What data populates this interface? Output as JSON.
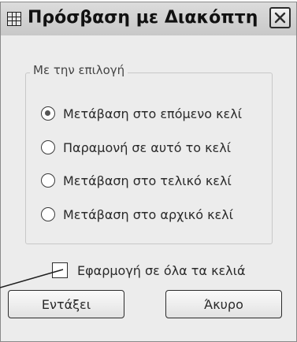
{
  "window": {
    "title": "Πρόσβαση με Διακόπτη",
    "icons": {
      "app": "grid-icon",
      "close": "close-icon"
    }
  },
  "group": {
    "legend": "Με την επιλογή",
    "options": [
      {
        "label": "Μετάβαση στο επόμενο κελί",
        "selected": true
      },
      {
        "label": "Παραμονή σε αυτό το κελί",
        "selected": false
      },
      {
        "label": "Μετάβαση στο τελικό κελί",
        "selected": false
      },
      {
        "label": "Μετάβαση στο αρχικό κελί",
        "selected": false
      }
    ]
  },
  "apply_all": {
    "label": "Εφαρμογή σε όλα τα κελιά",
    "checked": false
  },
  "buttons": {
    "ok": "Εντάξει",
    "cancel": "Άκυρο"
  },
  "colors": {
    "window_bg": "#ececec",
    "titlebar": "#d2d2d2",
    "border": "#2c2c2c"
  }
}
